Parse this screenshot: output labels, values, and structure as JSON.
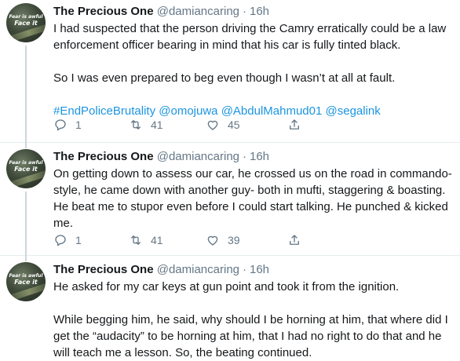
{
  "avatar": {
    "line1": "Fear is awful",
    "line2": "Face it"
  },
  "tweets": [
    {
      "name": "The Precious One",
      "handle": "@damiancaring",
      "dot": "·",
      "time": "16h",
      "paragraphs": [
        "I had suspected that the person driving the Camry erratically could be a law enforcement officer bearing in mind that his car is fully tinted black.",
        "So I was even prepared to beg even though I wasn’t at all at fault."
      ],
      "links": [
        "#EndPoliceBrutality",
        "@omojuwa",
        "@AbdulMahmud01",
        "@segalink"
      ],
      "replies": "1",
      "retweets": "41",
      "likes": "45"
    },
    {
      "name": "The Precious One",
      "handle": "@damiancaring",
      "dot": "·",
      "time": "16h",
      "paragraphs": [
        "On getting down to assess our car, he crossed us on the road in commando-style, he came down with another guy- both in mufti, staggering & boasting. He beat me to stupor even before I could start talking. He punched & kicked me."
      ],
      "replies": "1",
      "retweets": "41",
      "likes": "39"
    },
    {
      "name": "The Precious One",
      "handle": "@damiancaring",
      "dot": "·",
      "time": "16h",
      "paragraphs": [
        "He asked for my car keys at gun point and took it from the ignition.",
        "While begging him, he said, why should I be horning at him, that where did I get the “audacity” to be horning at him, that I had no right to do that and he will teach me a lesson. So, the beating continued."
      ]
    }
  ],
  "icons": {
    "reply": "reply-icon",
    "retweet": "retweet-icon",
    "like": "heart-icon",
    "share": "share-icon"
  },
  "colors": {
    "link": "#1b95e0",
    "secondary": "#657786",
    "text": "#14171a",
    "divider": "#e6ecf0"
  }
}
